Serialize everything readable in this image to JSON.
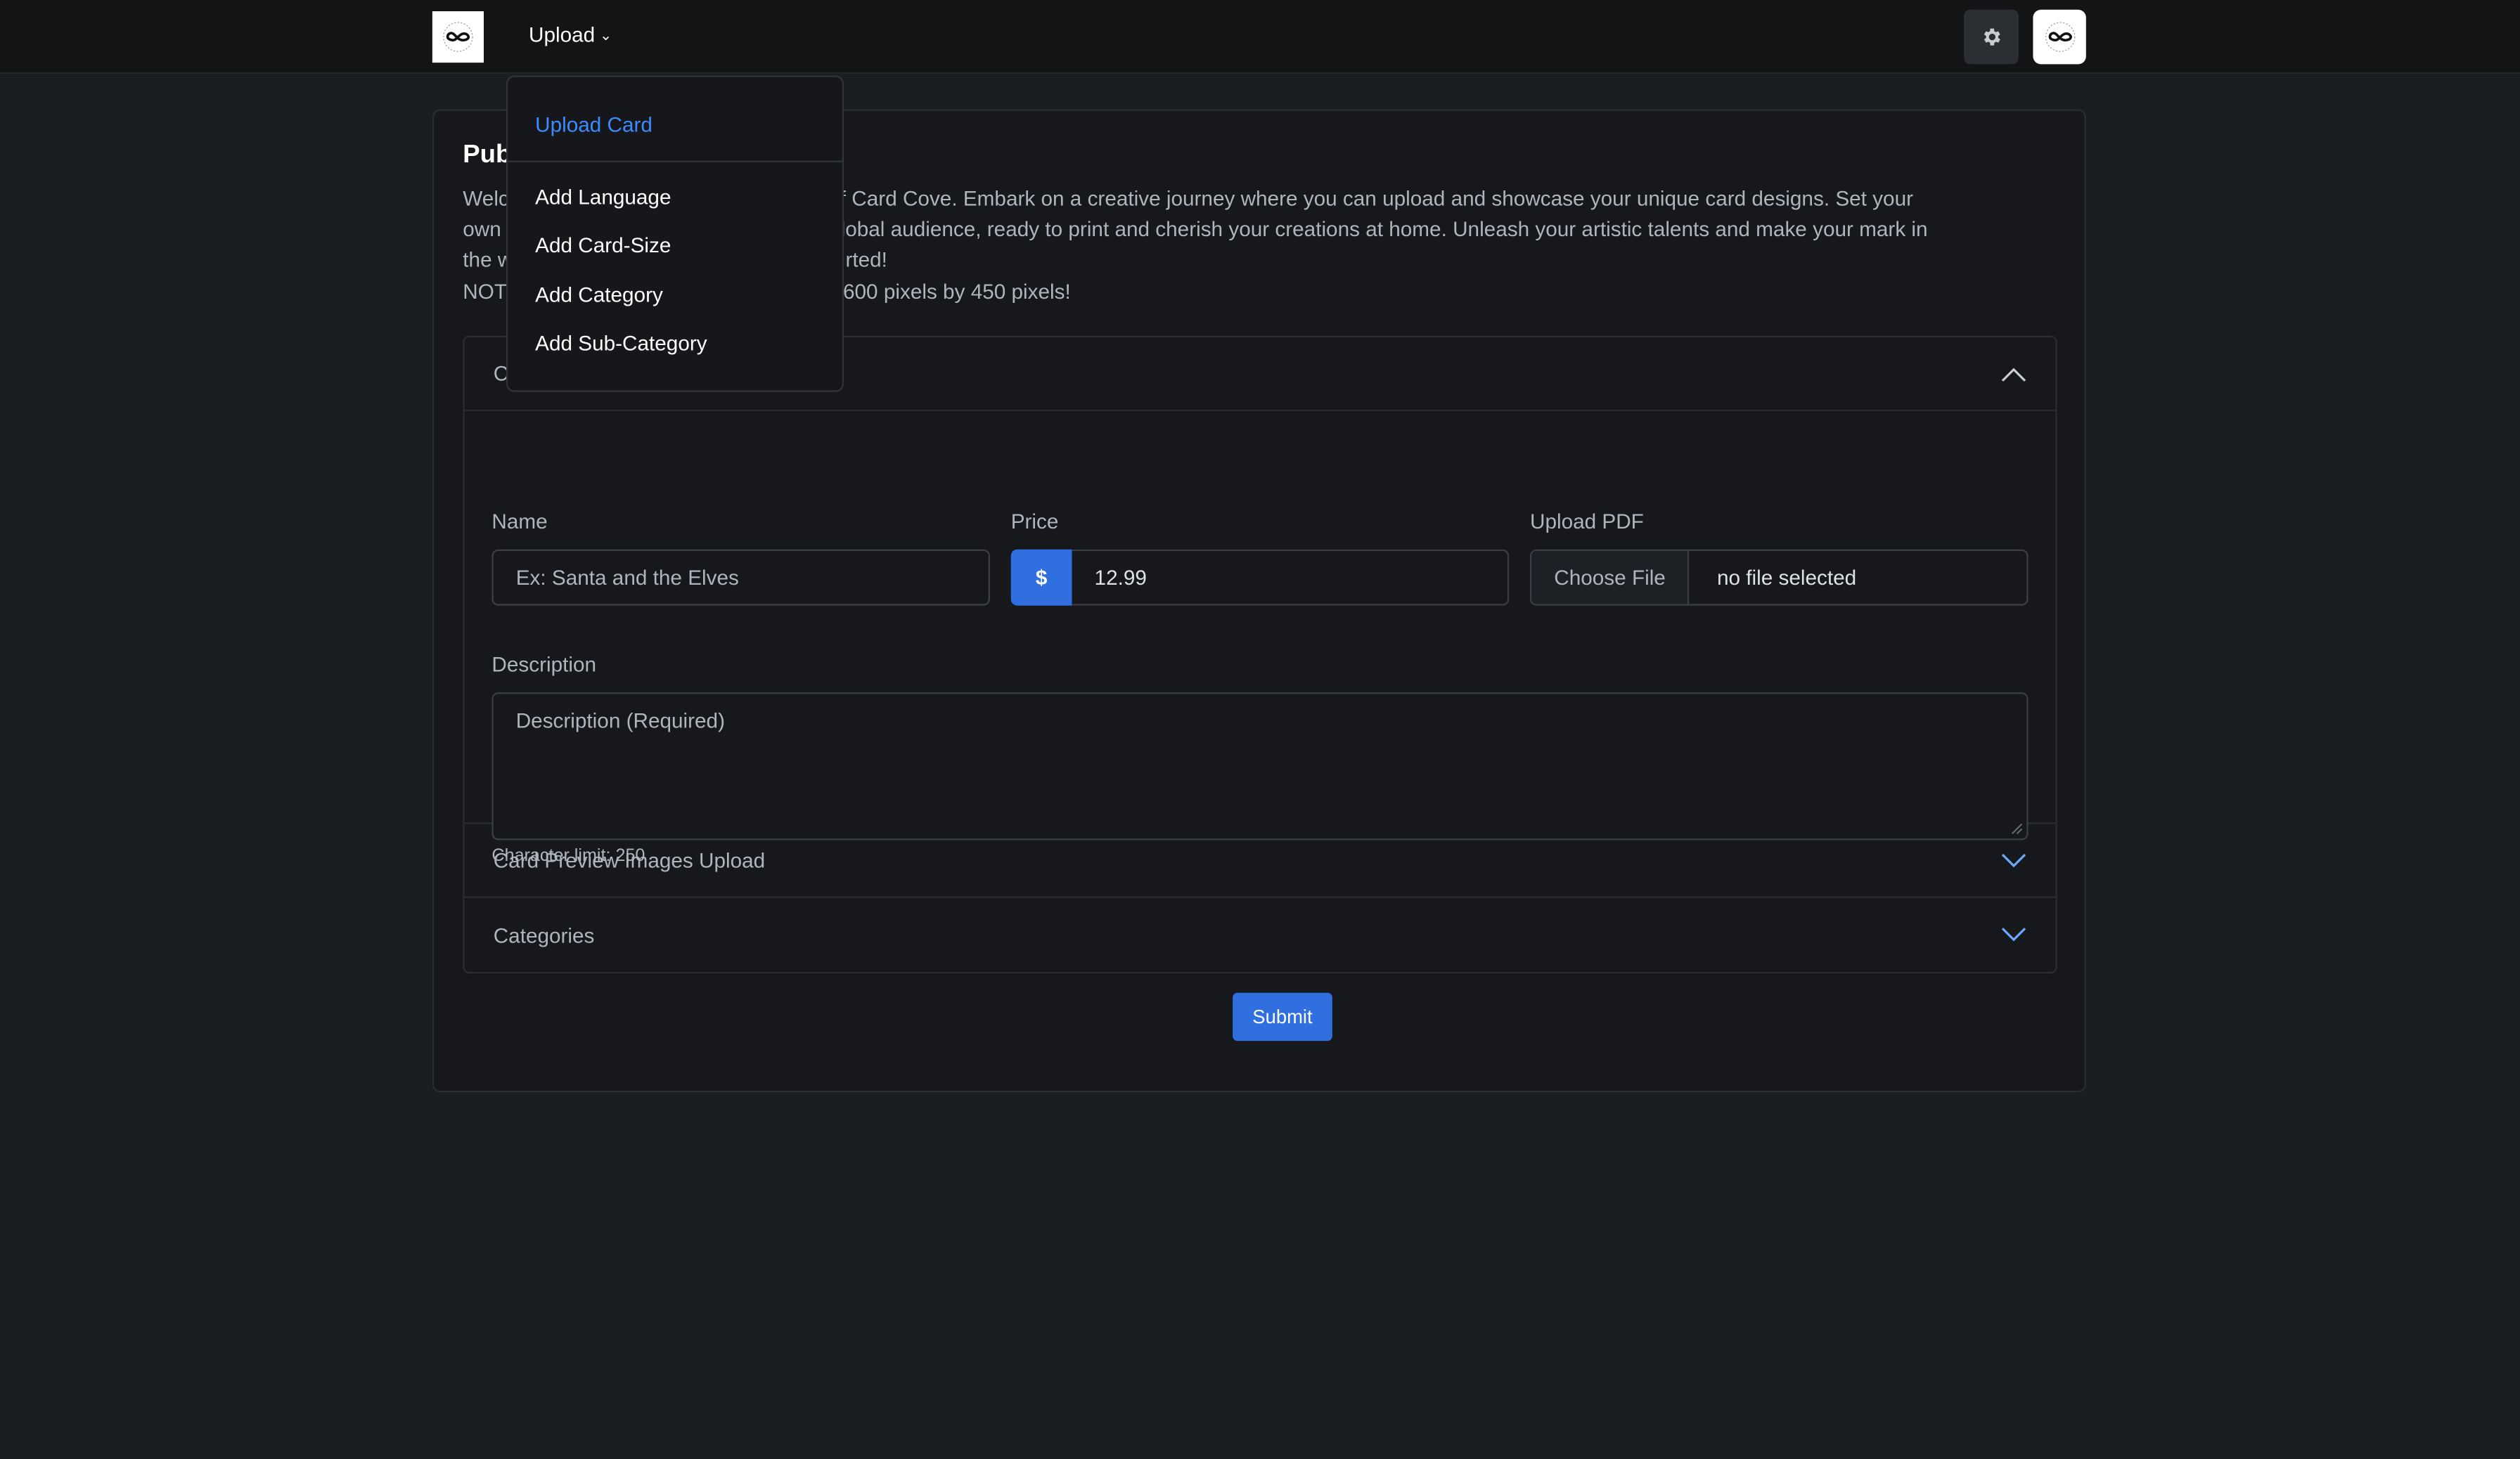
{
  "navbar": {
    "upload_menu_label": "Upload"
  },
  "upload_menu": {
    "items": [
      {
        "label": "Upload Card",
        "active": true
      },
      {
        "label": "Add Language"
      },
      {
        "label": "Add Card-Size"
      },
      {
        "label": "Add Category"
      },
      {
        "label": "Add Sub-Category"
      }
    ]
  },
  "page": {
    "title_visible": "Pub",
    "intro_lines": [
      "Welc",
      "own",
      "the w",
      "NOT"
    ],
    "intro_line_tails": [
      "d of Card Cove. Embark on a creative journey where you can upload and showcase your unique card designs. Set your",
      "global audience, ready to print and cherish your creations at home. Unleash your artistic talents and make your mark in",
      "rted!",
      "y 600 pixels by 450 pixels!"
    ]
  },
  "form": {
    "section_header_visible": "C",
    "name_label": "Name",
    "name_placeholder": "Ex: Santa and the Elves",
    "price_label": "Price",
    "price_addon": "$",
    "price_value": "12.99",
    "pdf_label": "Upload PDF",
    "file_button": "Choose File",
    "file_status": "no file selected",
    "description_label": "Description",
    "description_placeholder": "Description (Required)",
    "char_limit": "Character limit: 250"
  },
  "sections": [
    {
      "label": "Card Preview Images Upload"
    },
    {
      "label": "Categories"
    }
  ],
  "submit_label": "Submit",
  "colors": {
    "accent": "#2f6fdf",
    "active_link": "#3d8bfd",
    "background": "#1a1d22"
  }
}
